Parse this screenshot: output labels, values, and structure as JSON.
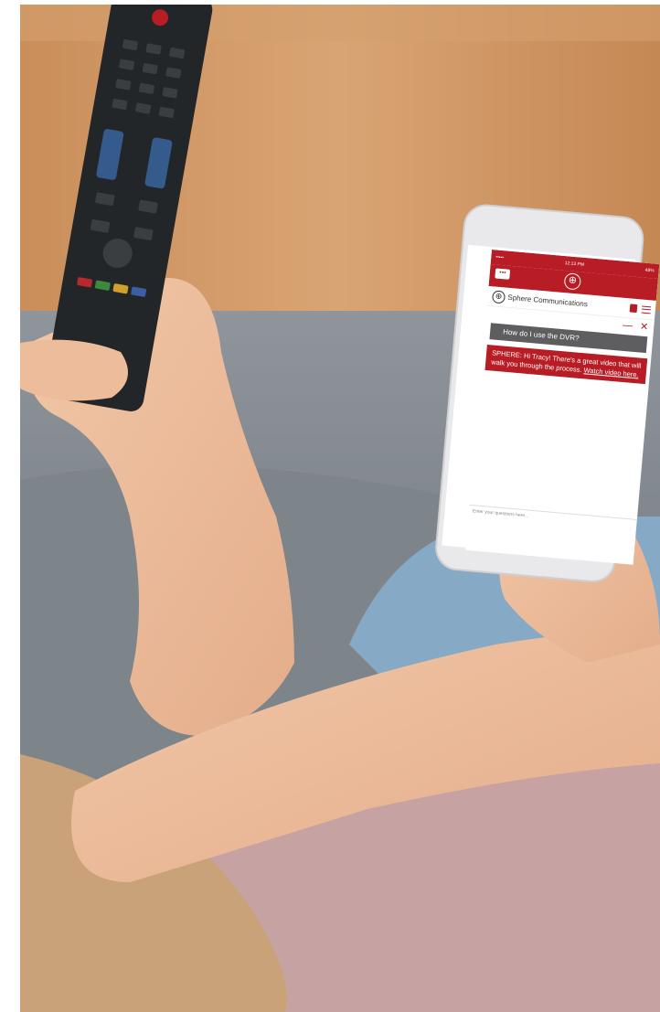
{
  "phone": {
    "status_time": "12:13 PM",
    "status_carrier": "•••••",
    "status_battery": "48%",
    "app_brand": "Sphere Communications",
    "minimize_label": "—",
    "close_label": "✕",
    "question": "How do I use the DVR?",
    "answer_text": "SPHERE: Hi Tracy! There's a great video that will walk you through the process. ",
    "answer_link": "Watch video here.",
    "input_placeholder": "Enter your questions here..."
  },
  "icons": {
    "chat": "chat-bubble-icon",
    "globe": "globe-icon",
    "lock": "lock-icon",
    "menu": "hamburger-menu-icon"
  },
  "colors": {
    "brand_red": "#b81c25",
    "question_grey": "#5e5e60"
  }
}
